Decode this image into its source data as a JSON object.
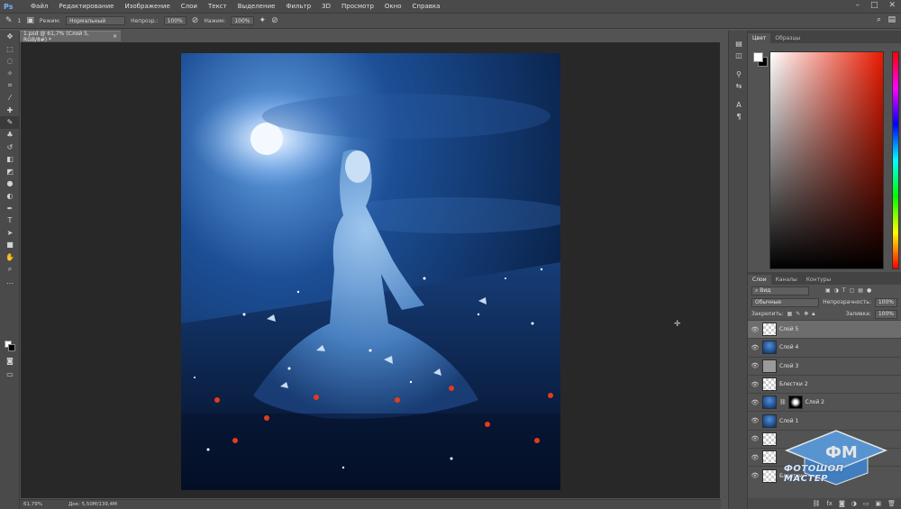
{
  "app": {
    "logo": "Ps"
  },
  "menubar": {
    "items": [
      "Файл",
      "Редактирование",
      "Изображение",
      "Слои",
      "Текст",
      "Выделение",
      "Фильтр",
      "3D",
      "Просмотр",
      "Окно",
      "Справка"
    ],
    "window_controls": {
      "minimize": "–",
      "maximize": "□",
      "close": "✕"
    }
  },
  "options": {
    "brush_size": "1",
    "mode_label": "Режим:",
    "mode_value": "Нормальный",
    "opacity_label": "Непрозр.:",
    "opacity_value": "100%",
    "flow_label": "Нажим:",
    "flow_value": "100%"
  },
  "document_tab": {
    "title": "1.psd @ 61,7% (Слой 5, RGB/8#) *",
    "close": "×"
  },
  "statusbar": {
    "zoom": "61,79%",
    "doc_info": "Док: 5,50M/139,4M"
  },
  "color_panel": {
    "tabs": [
      "Цвет",
      "Образцы"
    ],
    "fg_color": "#ffffff",
    "bg_color": "#000000"
  },
  "layers_panel": {
    "tabs": [
      "Слои",
      "Каналы",
      "Контуры"
    ],
    "filter_label": "Вид",
    "blend_mode": "Обычные",
    "opacity_label": "Непрозрачность:",
    "opacity_value": "100%",
    "lock_label": "Закрепить:",
    "fill_label": "Заливка:",
    "fill_value": "100%",
    "layers": [
      {
        "name": "Слой 5",
        "thumb": "checker",
        "selected": true
      },
      {
        "name": "Слой 4",
        "thumb": "blue",
        "selected": false
      },
      {
        "name": "Слой 3",
        "thumb": "gray",
        "selected": false
      },
      {
        "name": "Блестки 2",
        "thumb": "checker",
        "selected": false
      },
      {
        "name": "Слой 2",
        "thumb": "blue",
        "selected": false,
        "mask": true
      },
      {
        "name": "Слой 1",
        "thumb": "blue",
        "selected": false
      },
      {
        "name": "",
        "thumb": "checker",
        "selected": false
      },
      {
        "name": "",
        "thumb": "checker",
        "selected": false
      },
      {
        "name": "Блестки",
        "thumb": "checker",
        "selected": false
      }
    ]
  },
  "watermark": {
    "text": "ФОТОШОП МАСТЕР"
  }
}
